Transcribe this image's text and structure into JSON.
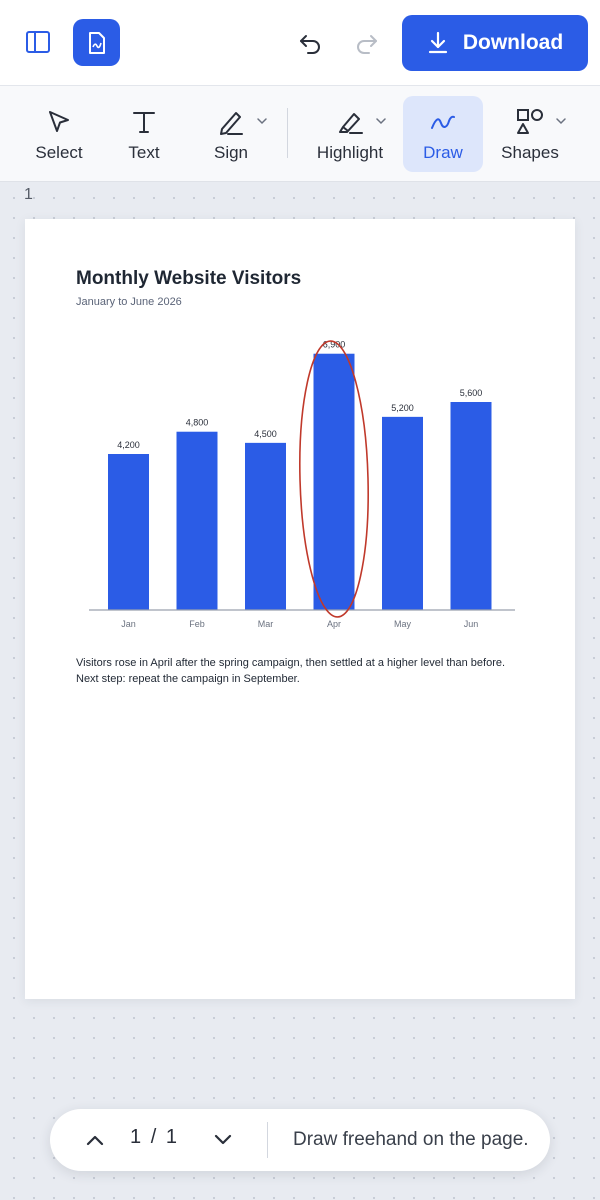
{
  "topbar": {
    "download_label": "Download"
  },
  "toolbar": {
    "tools": [
      {
        "label": "Select",
        "icon": "cursor-arrow-icon"
      },
      {
        "label": "Text",
        "icon": "text-icon"
      },
      {
        "label": "Sign",
        "icon": "pen-icon"
      },
      {
        "label": "Highlight",
        "icon": "highlighter-icon"
      },
      {
        "label": "Draw",
        "icon": "freehand-icon",
        "active": true
      },
      {
        "label": "Shapes",
        "icon": "shapes-icon"
      }
    ],
    "accent_color": "#2b5ce6",
    "active_bg_color": "#dde6fb"
  },
  "canvas": {
    "page_number": "1"
  },
  "document": {
    "title": "Monthly Website Visitors",
    "subtitle": "January to June 2026",
    "note": "Visitors rose in April after the spring campaign, then settled at a higher level than before. Next step: repeat the campaign in September."
  },
  "chart_data": {
    "type": "bar",
    "title": "Monthly Website Visitors",
    "subtitle": "January to June 2026",
    "categories": [
      "Jan",
      "Feb",
      "Mar",
      "Apr",
      "May",
      "Jun"
    ],
    "values": [
      4200,
      4800,
      4500,
      6900,
      5200,
      5600
    ],
    "value_labels": [
      "4,200",
      "4,800",
      "4,500",
      "6,900",
      "5,200",
      "5,600"
    ],
    "xlabel": "",
    "ylabel": "",
    "ylim": [
      0,
      7000
    ],
    "grid": false,
    "bar_color": "#2b5ce6",
    "annotation": {
      "type": "ellipse",
      "target": "Apr",
      "color": "#c0392b"
    }
  },
  "page_nav": {
    "current": "1",
    "separator": "/",
    "total": "1",
    "hint": "Draw freehand on the page."
  }
}
